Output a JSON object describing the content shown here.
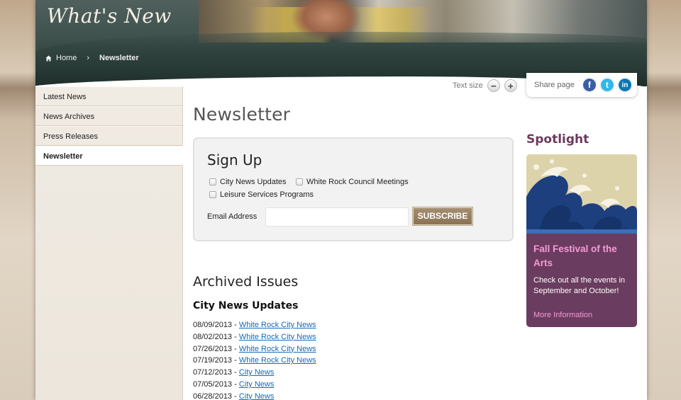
{
  "header": {
    "logo_text": "What's New",
    "breadcrumb": {
      "home": "Home",
      "separator": "›",
      "current": "Newsletter"
    }
  },
  "toolbar": {
    "text_size_label": "Text size",
    "decrease_label": "−",
    "increase_label": "+",
    "share_label": "Share page",
    "social": {
      "facebook": "f",
      "twitter": "t",
      "linkedin": "in"
    }
  },
  "sidebar": {
    "items": [
      {
        "label": "Latest News",
        "active": false
      },
      {
        "label": "News Archives",
        "active": false
      },
      {
        "label": "Press Releases",
        "active": false
      },
      {
        "label": "Newsletter",
        "active": true
      }
    ]
  },
  "main": {
    "title": "Newsletter",
    "signup": {
      "heading": "Sign Up",
      "options": [
        {
          "label": "City News Updates",
          "checked": false
        },
        {
          "label": "White Rock Council Meetings",
          "checked": false
        },
        {
          "label": "Leisure Services Programs",
          "checked": false
        }
      ],
      "email_label": "Email Address",
      "email_value": "",
      "subscribe_label": "SUBSCRIBE"
    },
    "archived": {
      "heading": "Archived Issues",
      "section": "City News Updates",
      "issues": [
        {
          "date": "08/09/2013",
          "link": "White Rock City News"
        },
        {
          "date": "08/02/2013",
          "link": "White Rock City News"
        },
        {
          "date": "07/26/2013",
          "link": "White Rock City News"
        },
        {
          "date": "07/19/2013",
          "link": "White Rock City News"
        },
        {
          "date": "07/12/2013",
          "link": "City News"
        },
        {
          "date": "07/05/2013",
          "link": "City News"
        },
        {
          "date": "06/28/2013",
          "link": "City News"
        }
      ]
    }
  },
  "spotlight": {
    "title": "Spotlight",
    "card_title": "Fall Festival of the Arts",
    "card_text": "Check out all the events in September and October!",
    "card_link": "More Information"
  },
  "colors": {
    "spotlight_bg": "#6a3c5f",
    "spotlight_accent": "#f59bd8",
    "link": "#1569b5",
    "subscribe_bg": "#8a7354"
  }
}
